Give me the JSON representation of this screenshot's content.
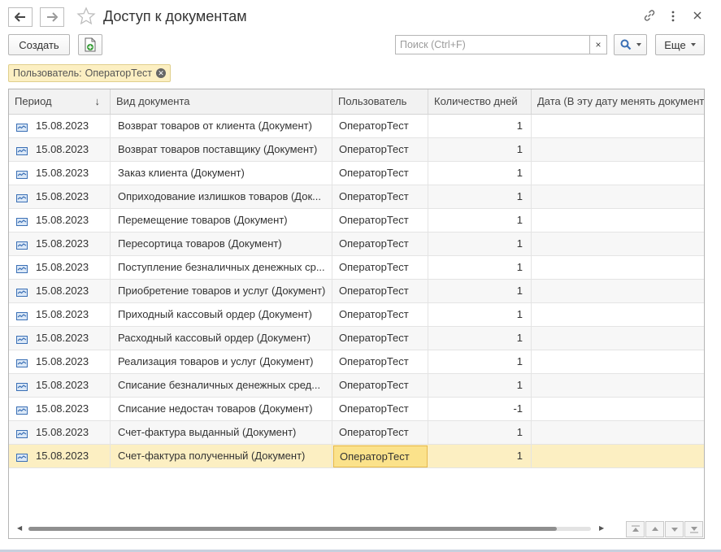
{
  "window": {
    "title": "Доступ к документам"
  },
  "toolbar": {
    "create_label": "Создать",
    "search_placeholder": "Поиск (Ctrl+F)",
    "search_clear": "×",
    "more_label": "Еще"
  },
  "filter": {
    "label": "Пользователь:",
    "value": "ОператорТест"
  },
  "table": {
    "columns": {
      "period": "Период",
      "doc_type": "Вид документа",
      "user": "Пользователь",
      "days": "Количество дней",
      "date": "Дата (В эту дату менять документ"
    },
    "sort_indicator": "↓",
    "rows": [
      {
        "period": "15.08.2023",
        "doc": "Возврат товаров от клиента (Документ)",
        "user": "ОператорТест",
        "days": "1"
      },
      {
        "period": "15.08.2023",
        "doc": "Возврат товаров поставщику (Документ)",
        "user": "ОператорТест",
        "days": "1"
      },
      {
        "period": "15.08.2023",
        "doc": "Заказ клиента (Документ)",
        "user": "ОператорТест",
        "days": "1"
      },
      {
        "period": "15.08.2023",
        "doc": "Оприходование излишков товаров (Док...",
        "user": "ОператорТест",
        "days": "1"
      },
      {
        "period": "15.08.2023",
        "doc": "Перемещение товаров (Документ)",
        "user": "ОператорТест",
        "days": "1"
      },
      {
        "period": "15.08.2023",
        "doc": "Пересортица товаров (Документ)",
        "user": "ОператорТест",
        "days": "1"
      },
      {
        "period": "15.08.2023",
        "doc": "Поступление безналичных денежных ср...",
        "user": "ОператорТест",
        "days": "1"
      },
      {
        "period": "15.08.2023",
        "doc": "Приобретение товаров и услуг (Документ)",
        "user": "ОператорТест",
        "days": "1"
      },
      {
        "period": "15.08.2023",
        "doc": "Приходный кассовый ордер (Документ)",
        "user": "ОператорТест",
        "days": "1"
      },
      {
        "period": "15.08.2023",
        "doc": "Расходный кассовый ордер (Документ)",
        "user": "ОператорТест",
        "days": "1"
      },
      {
        "period": "15.08.2023",
        "doc": "Реализация товаров и услуг (Документ)",
        "user": "ОператорТест",
        "days": "1"
      },
      {
        "period": "15.08.2023",
        "doc": "Списание безналичных денежных сред...",
        "user": "ОператорТест",
        "days": "1"
      },
      {
        "period": "15.08.2023",
        "doc": "Списание недостач товаров (Документ)",
        "user": "ОператорТест",
        "days": "-1"
      },
      {
        "period": "15.08.2023",
        "doc": "Счет-фактура выданный (Документ)",
        "user": "ОператорТест",
        "days": "1"
      },
      {
        "period": "15.08.2023",
        "doc": "Счет-фактура полученный (Документ)",
        "user": "ОператорТест",
        "days": "1"
      }
    ],
    "selected_row_index": 14
  },
  "colors": {
    "selection": "#fcefc2",
    "focus_cell": "#fbe28b",
    "accent_blue": "#3a6fb5"
  }
}
